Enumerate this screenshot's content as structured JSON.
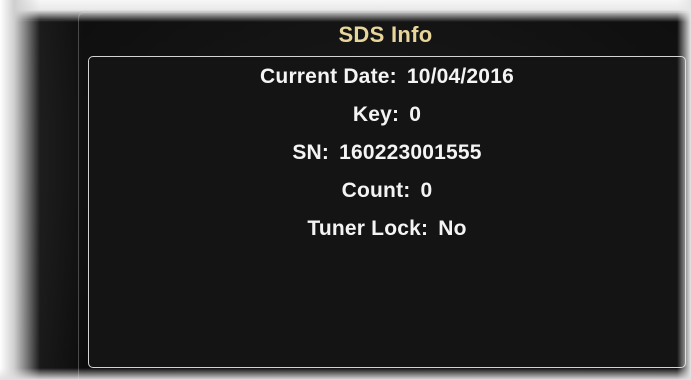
{
  "dialog": {
    "title": "SDS Info",
    "lines": [
      {
        "label": "Current Date:",
        "value": "10/04/2016"
      },
      {
        "label": "Key:",
        "value": "0"
      },
      {
        "label": "SN:",
        "value": "160223001555"
      },
      {
        "label": "Count:",
        "value": "0"
      },
      {
        "label": "Tuner Lock:",
        "value": "No"
      }
    ]
  },
  "colors": {
    "title": "#e8d59c",
    "text": "#f4f4f4",
    "panel_border": "#d4d4d4",
    "background": "#141414"
  }
}
